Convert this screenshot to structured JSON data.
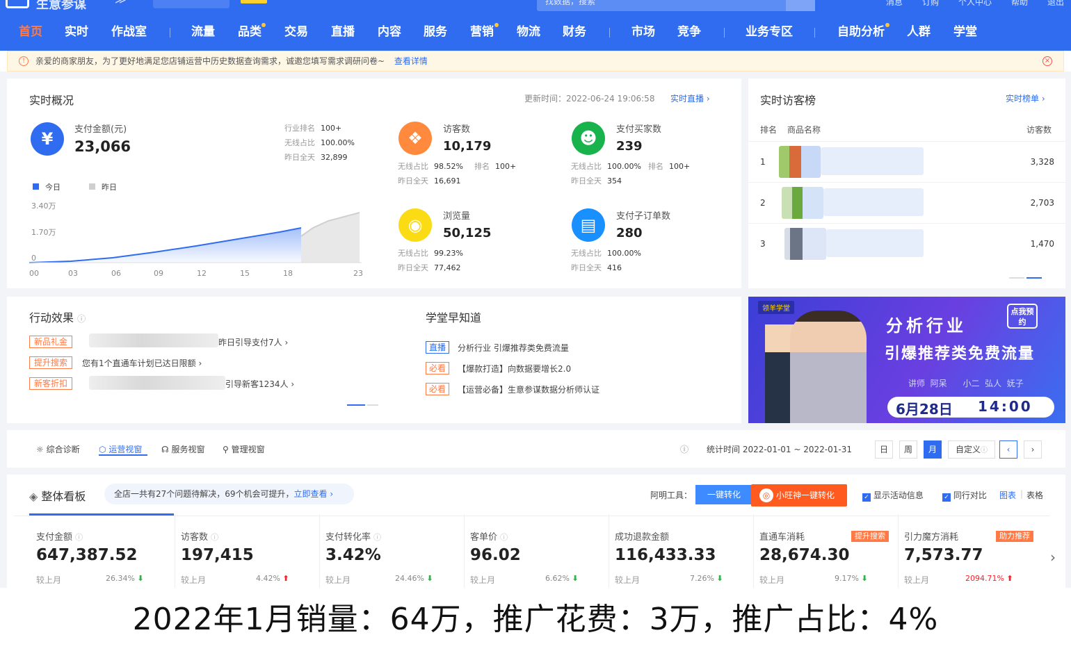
{
  "topbar": {
    "app_title": "生意参谋",
    "search_placeholder": "找数据，搜索",
    "links": [
      "消息",
      "订购",
      "个人中心",
      "帮助",
      "退出"
    ]
  },
  "nav": {
    "items": [
      "首页",
      "实时",
      "作战室",
      "流量",
      "品类",
      "交易",
      "直播",
      "内容",
      "服务",
      "营销",
      "物流",
      "财务",
      "市场",
      "竞争",
      "业务专区",
      "自助分析",
      "人群",
      "学堂"
    ],
    "active": "首页"
  },
  "notice": {
    "text": "亲爱的商家朋友，为了更好地满足您店铺运营中历史数据查询需求，诚邀您填写需求调研问卷~",
    "link": "查看详情"
  },
  "realtime": {
    "title": "实时概况",
    "update_time": "更新时间：2022-06-24 19:06:58",
    "live_link": "实时直播",
    "pay_amount": {
      "label": "支付金额(元)",
      "value": "23,066",
      "rank_label": "行业排名",
      "rank": "100+",
      "wireless_label": "无线占比",
      "wireless": "100.00%",
      "yesterday_label": "昨日全天",
      "yesterday": "32,899"
    },
    "legend_today": "今日",
    "legend_yesterday": "昨日",
    "y_ticks": [
      "3.40万",
      "1.70万",
      "0"
    ],
    "x_ticks": [
      "00",
      "03",
      "06",
      "09",
      "12",
      "15",
      "18",
      "23"
    ],
    "visitors": {
      "label": "访客数",
      "value": "10,179",
      "wireless_label": "无线占比",
      "wireless": "98.52%",
      "rank_label": "排名",
      "rank": "100+",
      "yesterday_label": "昨日全天",
      "yesterday": "16,691"
    },
    "buyers": {
      "label": "支付买家数",
      "value": "239",
      "wireless_label": "无线占比",
      "wireless": "100.00%",
      "rank_label": "排名",
      "rank": "100+",
      "yesterday_label": "昨日全天",
      "yesterday": "354"
    },
    "pageviews": {
      "label": "浏览量",
      "value": "50,125",
      "wireless_label": "无线占比",
      "wireless": "99.23%",
      "yesterday_label": "昨日全天",
      "yesterday": "77,462"
    },
    "sub_orders": {
      "label": "支付子订单数",
      "value": "280",
      "wireless_label": "无线占比",
      "wireless": "100.00%",
      "yesterday_label": "昨日全天",
      "yesterday": "416"
    }
  },
  "visitor_rank": {
    "title": "实时访客榜",
    "link": "实时榜单",
    "col_rank": "排名",
    "col_name": "商品名称",
    "col_visitors": "访客数",
    "rows": [
      {
        "rank": "1",
        "visitors": "3,328"
      },
      {
        "rank": "2",
        "visitors": "2,703"
      },
      {
        "rank": "3",
        "visitors": "1,470"
      }
    ]
  },
  "action": {
    "title": "行动效果",
    "items": [
      {
        "tag": "新品礼金",
        "text": "昨日引导支付7人"
      },
      {
        "tag": "提升搜索",
        "text": "您有1个直通车计划已达日限额"
      },
      {
        "tag": "新客折扣",
        "text": "引导新客1234人"
      }
    ]
  },
  "school": {
    "title": "学堂早知道",
    "items": [
      {
        "tag": "直播",
        "text": "分析行业 引爆推荐类免费流量"
      },
      {
        "tag": "必看",
        "text": "【爆款打造】向数据要增长2.0"
      },
      {
        "tag": "必看",
        "text": "【运营必备】生意参谋数据分析师认证"
      }
    ]
  },
  "banner": {
    "brand": "领羊学堂",
    "line1": "分析行业",
    "line2": "引爆推荐类免费流量",
    "speakers": "讲师  阿呆      小二  弘人  妩子",
    "date": "6月28日",
    "time": "14:00",
    "book": "点我预约"
  },
  "tabs": {
    "items": [
      "综合诊断",
      "运营视窗",
      "服务视窗",
      "管理视窗"
    ],
    "active": "运营视窗",
    "stat_time": "统计时间 2022-01-01 ~ 2022-01-31",
    "periods": [
      "日",
      "周",
      "月"
    ],
    "active_period": "月",
    "custom": "自定义"
  },
  "dashboard": {
    "title": "整体看板",
    "hint": "全店一共有27个问题待解决，69个机会可提升，",
    "hint_link": "立即查看",
    "tool_label": "阿明工具：",
    "convert_btn": "一键转化",
    "wangwang_btn": "小旺神一键转化",
    "show_activity": "显示活动信息",
    "peer_compare": "同行对比",
    "view_chart": "图表",
    "view_table": "表格",
    "kpis": [
      {
        "label": "支付金额",
        "value": "647,387.52",
        "cmp": "较上月",
        "pct": "26.34%",
        "dir": "down"
      },
      {
        "label": "访客数",
        "value": "197,415",
        "cmp": "较上月",
        "pct": "4.42%",
        "dir": "up"
      },
      {
        "label": "支付转化率",
        "value": "3.42%",
        "cmp": "较上月",
        "pct": "24.46%",
        "dir": "down"
      },
      {
        "label": "客单价",
        "value": "96.02",
        "cmp": "较上月",
        "pct": "6.62%",
        "dir": "down"
      },
      {
        "label": "成功退款金额",
        "value": "116,433.33",
        "cmp": "较上月",
        "pct": "7.26%",
        "dir": "down"
      },
      {
        "label": "直通车消耗",
        "value": "28,674.30",
        "cmp": "较上月",
        "pct": "9.17%",
        "dir": "down",
        "badge": "提升搜索"
      },
      {
        "label": "引力魔方消耗",
        "value": "7,573.77",
        "cmp": "较上月",
        "pct": "2094.71%",
        "dir": "up",
        "badge": "助力推荐"
      }
    ]
  },
  "caption": "2022年1月销量：64万，推广花费：3万，推广占比：4%",
  "colors": {
    "brand": "#2f6cf0",
    "orange": "#ff7a45",
    "up": "#f5222d",
    "down": "#2bb34a"
  }
}
